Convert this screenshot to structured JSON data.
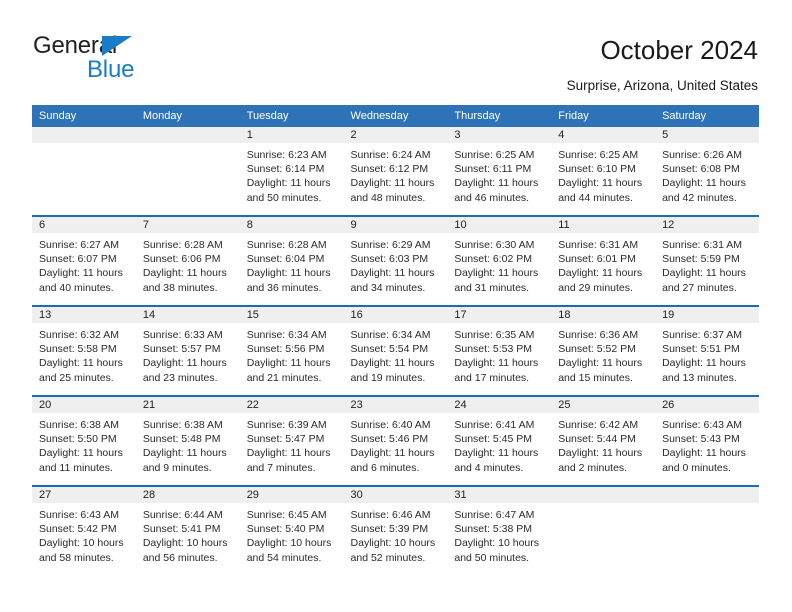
{
  "brand": {
    "name_part1": "General",
    "name_part2": "Blue",
    "logo_icon": "triangle-logo-icon",
    "accent_color": "#1a7cc4"
  },
  "header": {
    "title": "October 2024",
    "location": "Surprise, Arizona, United States"
  },
  "theme": {
    "header_blue": "#2e72b8",
    "row_divider_blue": "#1f6bb0",
    "daynum_band_gray": "#efefef"
  },
  "calendar": {
    "weekday_headers": [
      "Sunday",
      "Monday",
      "Tuesday",
      "Wednesday",
      "Thursday",
      "Friday",
      "Saturday"
    ],
    "weeks": [
      [
        {
          "day": "",
          "sunrise": "",
          "sunset": "",
          "daylight_line1": "",
          "daylight_line2": ""
        },
        {
          "day": "",
          "sunrise": "",
          "sunset": "",
          "daylight_line1": "",
          "daylight_line2": ""
        },
        {
          "day": "1",
          "sunrise": "Sunrise: 6:23 AM",
          "sunset": "Sunset: 6:14 PM",
          "daylight_line1": "Daylight: 11 hours",
          "daylight_line2": "and 50 minutes."
        },
        {
          "day": "2",
          "sunrise": "Sunrise: 6:24 AM",
          "sunset": "Sunset: 6:12 PM",
          "daylight_line1": "Daylight: 11 hours",
          "daylight_line2": "and 48 minutes."
        },
        {
          "day": "3",
          "sunrise": "Sunrise: 6:25 AM",
          "sunset": "Sunset: 6:11 PM",
          "daylight_line1": "Daylight: 11 hours",
          "daylight_line2": "and 46 minutes."
        },
        {
          "day": "4",
          "sunrise": "Sunrise: 6:25 AM",
          "sunset": "Sunset: 6:10 PM",
          "daylight_line1": "Daylight: 11 hours",
          "daylight_line2": "and 44 minutes."
        },
        {
          "day": "5",
          "sunrise": "Sunrise: 6:26 AM",
          "sunset": "Sunset: 6:08 PM",
          "daylight_line1": "Daylight: 11 hours",
          "daylight_line2": "and 42 minutes."
        }
      ],
      [
        {
          "day": "6",
          "sunrise": "Sunrise: 6:27 AM",
          "sunset": "Sunset: 6:07 PM",
          "daylight_line1": "Daylight: 11 hours",
          "daylight_line2": "and 40 minutes."
        },
        {
          "day": "7",
          "sunrise": "Sunrise: 6:28 AM",
          "sunset": "Sunset: 6:06 PM",
          "daylight_line1": "Daylight: 11 hours",
          "daylight_line2": "and 38 minutes."
        },
        {
          "day": "8",
          "sunrise": "Sunrise: 6:28 AM",
          "sunset": "Sunset: 6:04 PM",
          "daylight_line1": "Daylight: 11 hours",
          "daylight_line2": "and 36 minutes."
        },
        {
          "day": "9",
          "sunrise": "Sunrise: 6:29 AM",
          "sunset": "Sunset: 6:03 PM",
          "daylight_line1": "Daylight: 11 hours",
          "daylight_line2": "and 34 minutes."
        },
        {
          "day": "10",
          "sunrise": "Sunrise: 6:30 AM",
          "sunset": "Sunset: 6:02 PM",
          "daylight_line1": "Daylight: 11 hours",
          "daylight_line2": "and 31 minutes."
        },
        {
          "day": "11",
          "sunrise": "Sunrise: 6:31 AM",
          "sunset": "Sunset: 6:01 PM",
          "daylight_line1": "Daylight: 11 hours",
          "daylight_line2": "and 29 minutes."
        },
        {
          "day": "12",
          "sunrise": "Sunrise: 6:31 AM",
          "sunset": "Sunset: 5:59 PM",
          "daylight_line1": "Daylight: 11 hours",
          "daylight_line2": "and 27 minutes."
        }
      ],
      [
        {
          "day": "13",
          "sunrise": "Sunrise: 6:32 AM",
          "sunset": "Sunset: 5:58 PM",
          "daylight_line1": "Daylight: 11 hours",
          "daylight_line2": "and 25 minutes."
        },
        {
          "day": "14",
          "sunrise": "Sunrise: 6:33 AM",
          "sunset": "Sunset: 5:57 PM",
          "daylight_line1": "Daylight: 11 hours",
          "daylight_line2": "and 23 minutes."
        },
        {
          "day": "15",
          "sunrise": "Sunrise: 6:34 AM",
          "sunset": "Sunset: 5:56 PM",
          "daylight_line1": "Daylight: 11 hours",
          "daylight_line2": "and 21 minutes."
        },
        {
          "day": "16",
          "sunrise": "Sunrise: 6:34 AM",
          "sunset": "Sunset: 5:54 PM",
          "daylight_line1": "Daylight: 11 hours",
          "daylight_line2": "and 19 minutes."
        },
        {
          "day": "17",
          "sunrise": "Sunrise: 6:35 AM",
          "sunset": "Sunset: 5:53 PM",
          "daylight_line1": "Daylight: 11 hours",
          "daylight_line2": "and 17 minutes."
        },
        {
          "day": "18",
          "sunrise": "Sunrise: 6:36 AM",
          "sunset": "Sunset: 5:52 PM",
          "daylight_line1": "Daylight: 11 hours",
          "daylight_line2": "and 15 minutes."
        },
        {
          "day": "19",
          "sunrise": "Sunrise: 6:37 AM",
          "sunset": "Sunset: 5:51 PM",
          "daylight_line1": "Daylight: 11 hours",
          "daylight_line2": "and 13 minutes."
        }
      ],
      [
        {
          "day": "20",
          "sunrise": "Sunrise: 6:38 AM",
          "sunset": "Sunset: 5:50 PM",
          "daylight_line1": "Daylight: 11 hours",
          "daylight_line2": "and 11 minutes."
        },
        {
          "day": "21",
          "sunrise": "Sunrise: 6:38 AM",
          "sunset": "Sunset: 5:48 PM",
          "daylight_line1": "Daylight: 11 hours",
          "daylight_line2": "and 9 minutes."
        },
        {
          "day": "22",
          "sunrise": "Sunrise: 6:39 AM",
          "sunset": "Sunset: 5:47 PM",
          "daylight_line1": "Daylight: 11 hours",
          "daylight_line2": "and 7 minutes."
        },
        {
          "day": "23",
          "sunrise": "Sunrise: 6:40 AM",
          "sunset": "Sunset: 5:46 PM",
          "daylight_line1": "Daylight: 11 hours",
          "daylight_line2": "and 6 minutes."
        },
        {
          "day": "24",
          "sunrise": "Sunrise: 6:41 AM",
          "sunset": "Sunset: 5:45 PM",
          "daylight_line1": "Daylight: 11 hours",
          "daylight_line2": "and 4 minutes."
        },
        {
          "day": "25",
          "sunrise": "Sunrise: 6:42 AM",
          "sunset": "Sunset: 5:44 PM",
          "daylight_line1": "Daylight: 11 hours",
          "daylight_line2": "and 2 minutes."
        },
        {
          "day": "26",
          "sunrise": "Sunrise: 6:43 AM",
          "sunset": "Sunset: 5:43 PM",
          "daylight_line1": "Daylight: 11 hours",
          "daylight_line2": "and 0 minutes."
        }
      ],
      [
        {
          "day": "27",
          "sunrise": "Sunrise: 6:43 AM",
          "sunset": "Sunset: 5:42 PM",
          "daylight_line1": "Daylight: 10 hours",
          "daylight_line2": "and 58 minutes."
        },
        {
          "day": "28",
          "sunrise": "Sunrise: 6:44 AM",
          "sunset": "Sunset: 5:41 PM",
          "daylight_line1": "Daylight: 10 hours",
          "daylight_line2": "and 56 minutes."
        },
        {
          "day": "29",
          "sunrise": "Sunrise: 6:45 AM",
          "sunset": "Sunset: 5:40 PM",
          "daylight_line1": "Daylight: 10 hours",
          "daylight_line2": "and 54 minutes."
        },
        {
          "day": "30",
          "sunrise": "Sunrise: 6:46 AM",
          "sunset": "Sunset: 5:39 PM",
          "daylight_line1": "Daylight: 10 hours",
          "daylight_line2": "and 52 minutes."
        },
        {
          "day": "31",
          "sunrise": "Sunrise: 6:47 AM",
          "sunset": "Sunset: 5:38 PM",
          "daylight_line1": "Daylight: 10 hours",
          "daylight_line2": "and 50 minutes."
        },
        {
          "day": "",
          "sunrise": "",
          "sunset": "",
          "daylight_line1": "",
          "daylight_line2": ""
        },
        {
          "day": "",
          "sunrise": "",
          "sunset": "",
          "daylight_line1": "",
          "daylight_line2": ""
        }
      ]
    ]
  }
}
